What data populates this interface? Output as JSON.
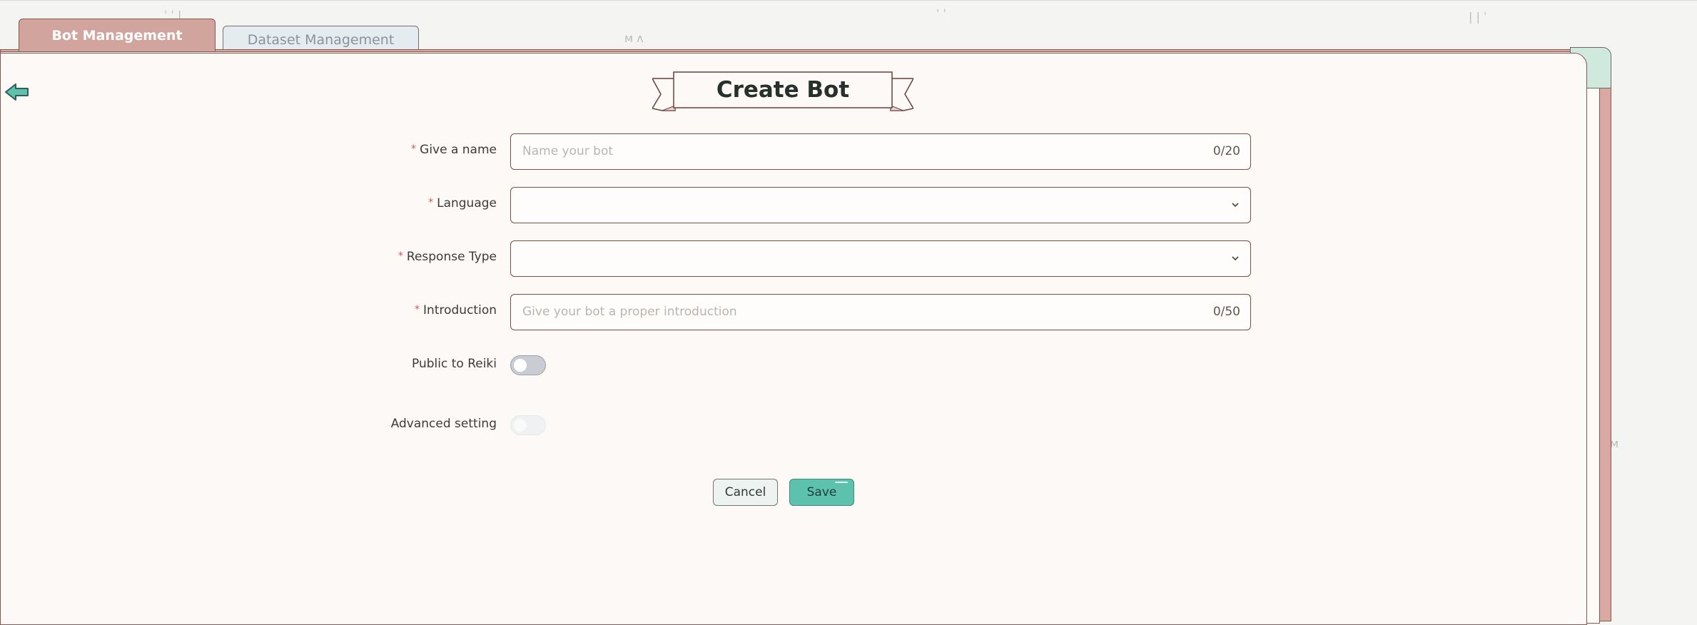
{
  "tabs": [
    {
      "label": "Bot Management",
      "active": true
    },
    {
      "label": "Dataset Management",
      "active": false
    }
  ],
  "page": {
    "title": "Create Bot",
    "back_icon": "arrow-left-icon"
  },
  "form": {
    "name": {
      "label": "Give a name",
      "required": true,
      "placeholder": "Name your bot",
      "counter": "0/20"
    },
    "language": {
      "label": "Language",
      "required": true,
      "value": ""
    },
    "response_type": {
      "label": "Response Type",
      "required": true,
      "value": ""
    },
    "introduction": {
      "label": "Introduction",
      "required": true,
      "placeholder": "Give your bot a proper introduction",
      "counter": "0/50"
    },
    "public": {
      "label": "Public to Reiki",
      "on": false
    },
    "advanced": {
      "label": "Advanced setting",
      "on": false
    }
  },
  "actions": {
    "cancel_label": "Cancel",
    "save_label": "Save"
  },
  "colors": {
    "accent": "#5cc2ad",
    "tab_active": "#d2a49e",
    "required_mark": "#e0524f",
    "border": "#7a4d47"
  }
}
